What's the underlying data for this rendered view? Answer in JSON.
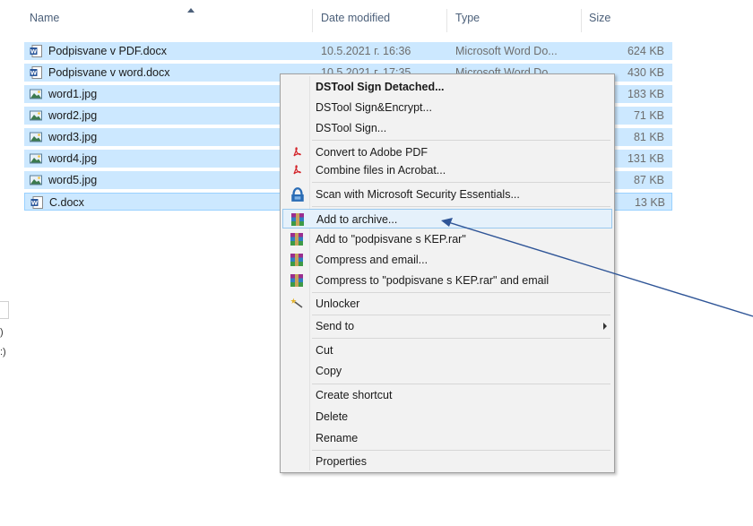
{
  "columns": {
    "name": "Name",
    "date": "Date modified",
    "type": "Type",
    "size": "Size"
  },
  "files": [
    {
      "name": "Podpisvane v PDF.docx",
      "date": "10.5.2021 г. 16:36",
      "type": "Microsoft Word Do...",
      "size": "624 KB",
      "icon": "word-doc-icon"
    },
    {
      "name": "Podpisvane v word.docx",
      "date": "10.5.2021 г. 17:35",
      "type": "Microsoft Word Do...",
      "size": "430 KB",
      "icon": "word-doc-icon"
    },
    {
      "name": "word1.jpg",
      "size": "183 KB",
      "icon": "image-file-icon"
    },
    {
      "name": "word2.jpg",
      "size": "71 KB",
      "icon": "image-file-icon"
    },
    {
      "name": "word3.jpg",
      "size": "81 KB",
      "icon": "image-file-icon"
    },
    {
      "name": "word4.jpg",
      "size": "131 KB",
      "icon": "image-file-icon"
    },
    {
      "name": "word5.jpg",
      "size": "87 KB",
      "icon": "image-file-icon"
    },
    {
      "name": "C.docx",
      "size": "13 KB",
      "icon": "word-doc-icon"
    }
  ],
  "menu": {
    "items": [
      {
        "label": "DSTool Sign Detached...",
        "bold": true
      },
      {
        "label": "DSTool Sign&Encrypt..."
      },
      {
        "label": "DSTool Sign..."
      },
      {
        "label": "Convert to Adobe PDF",
        "icon": "adobe-pdf-icon"
      },
      {
        "label": "Combine files in Acrobat...",
        "icon": "acrobat-combine-icon"
      },
      {
        "label": "Scan with Microsoft Security Essentials...",
        "icon": "security-essentials-icon"
      },
      {
        "label": "Add to archive...",
        "icon": "winrar-icon",
        "highlighted": true
      },
      {
        "label": "Add to \"podpisvane s KEP.rar\"",
        "icon": "winrar-icon"
      },
      {
        "label": "Compress and email...",
        "icon": "winrar-icon"
      },
      {
        "label": "Compress to \"podpisvane s KEP.rar\" and email",
        "icon": "winrar-icon"
      },
      {
        "label": "Unlocker",
        "icon": "unlocker-wand-icon"
      },
      {
        "label": "Send to",
        "submenu": true
      },
      {
        "label": "Cut"
      },
      {
        "label": "Copy"
      },
      {
        "label": "Create shortcut"
      },
      {
        "label": "Delete"
      },
      {
        "label": "Rename"
      },
      {
        "label": "Properties"
      }
    ]
  },
  "left_pane": {
    "fragment_a": ")",
    "fragment_b": ":)"
  },
  "colors": {
    "selection": "#cce8ff",
    "menu_bg": "#f2f2f2",
    "hover": "#e5f1fb",
    "arrow": "#2f5597"
  }
}
